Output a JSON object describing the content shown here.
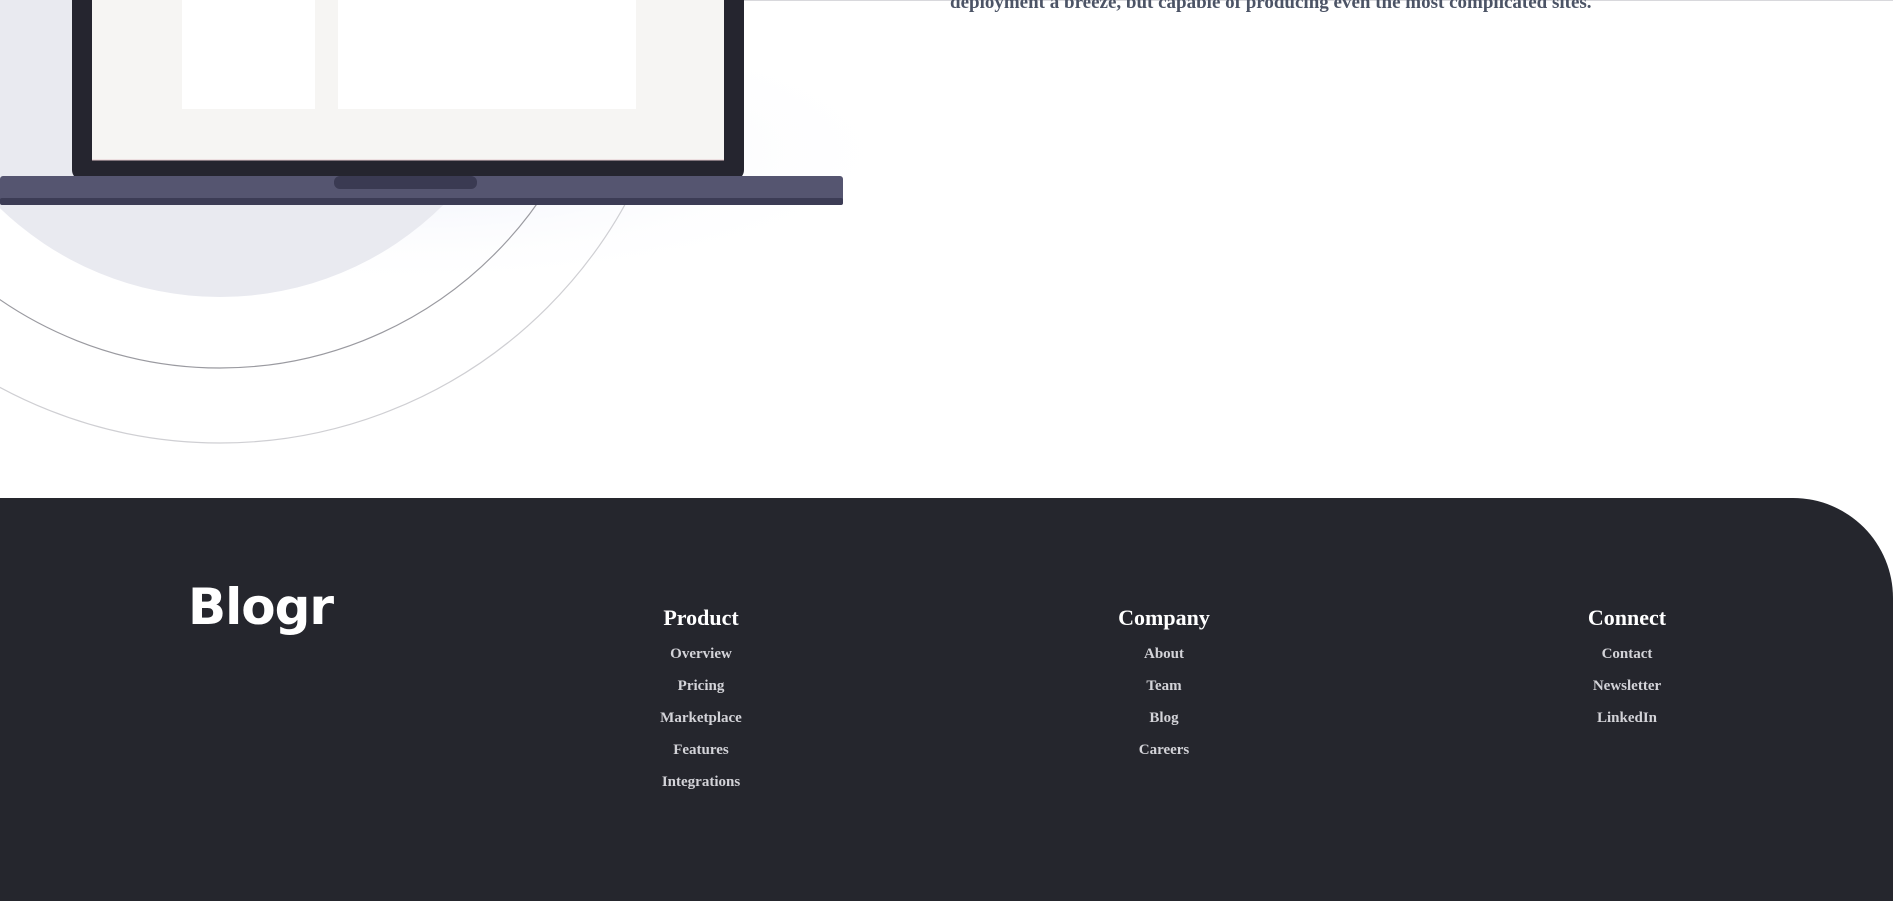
{
  "intro": {
    "text": "deployment a breeze, but capable of producing even the most complicated sites."
  },
  "footer": {
    "logo": "Blogr",
    "columns": [
      {
        "title": "Product",
        "links": [
          "Overview",
          "Pricing",
          "Marketplace",
          "Features",
          "Integrations"
        ]
      },
      {
        "title": "Company",
        "links": [
          "About",
          "Team",
          "Blog",
          "Careers"
        ]
      },
      {
        "title": "Connect",
        "links": [
          "Contact",
          "Newsletter",
          "LinkedIn"
        ]
      }
    ]
  },
  "colors": {
    "footer_bg": "#25262d",
    "laptop_body": "#555570",
    "body_text": "#4c5466"
  }
}
